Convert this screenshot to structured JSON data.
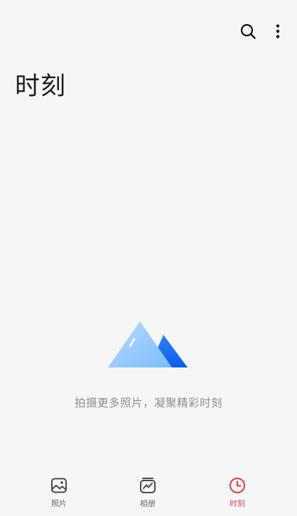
{
  "header": {
    "title": "时刻",
    "search_icon": "search-icon",
    "more_icon": "more-vertical-icon"
  },
  "empty_state": {
    "illustration": "mountain-icon",
    "message": "拍摄更多照片，凝聚精彩时刻"
  },
  "bottom_nav": {
    "items": [
      {
        "label": "照片",
        "icon": "photo-icon",
        "active": false
      },
      {
        "label": "相册",
        "icon": "album-icon",
        "active": false
      },
      {
        "label": "时刻",
        "icon": "clock-icon",
        "active": true
      }
    ]
  },
  "colors": {
    "background": "#f6f6f6",
    "accent": "#e04650",
    "inactive": "#5a5a5a",
    "mountain_light": "#8cc6ff",
    "mountain_dark": "#1a6cf0"
  }
}
